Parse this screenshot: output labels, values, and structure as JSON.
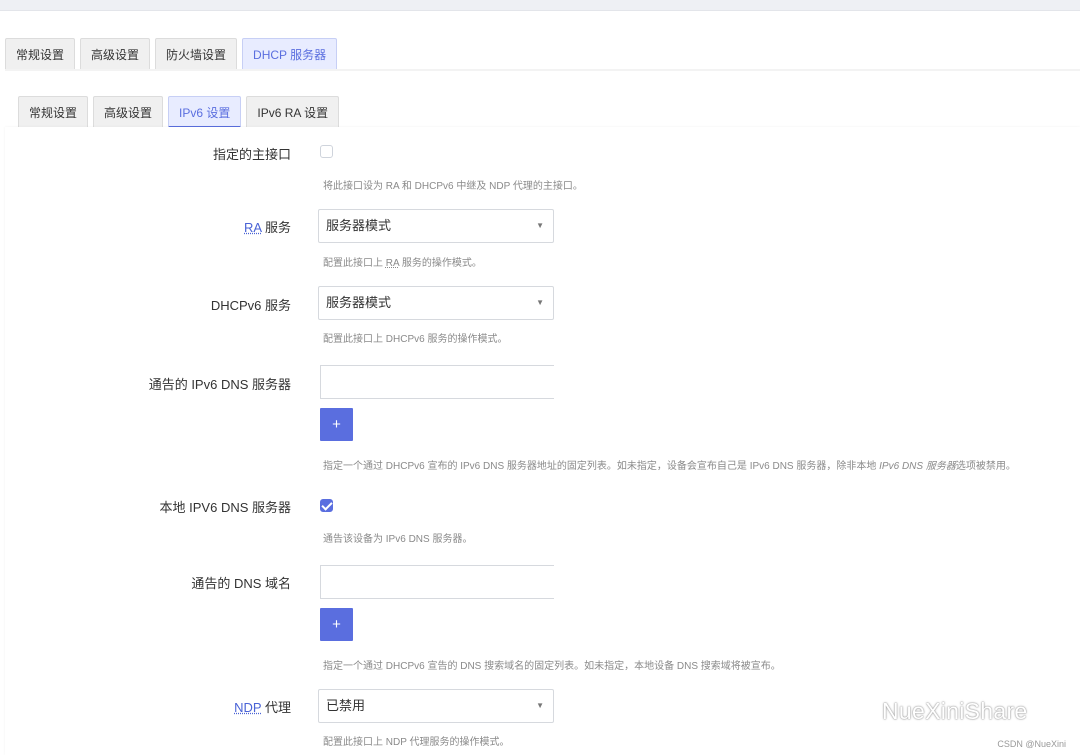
{
  "top_tabs": [
    "常规设置",
    "高级设置",
    "防火墙设置",
    "DHCP 服务器"
  ],
  "sub_tabs": [
    "常规设置",
    "高级设置",
    "IPv6 设置",
    "IPv6 RA 设置"
  ],
  "fields": {
    "master": {
      "label": "指定的主接口",
      "checked": false,
      "help": "将此接口设为 RA 和 DHCPv6 中继及 NDP 代理的主接口。"
    },
    "ra_service": {
      "label_abbr": "RA",
      "label_rest": " 服务",
      "value": "服务器模式",
      "help_pre": "配置此接口上 ",
      "help_abbr": "RA",
      "help_post": " 服务的操作模式。"
    },
    "dhcpv6_service": {
      "label": "DHCPv6 服务",
      "value": "服务器模式",
      "help": "配置此接口上 DHCPv6 服务的操作模式。"
    },
    "announced_dns": {
      "label": "通告的 IPv6 DNS 服务器",
      "value": "",
      "add_label": "+",
      "help_pre": "指定一个通过 DHCPv6 宣布的 IPv6 DNS 服务器地址的固定列表。如未指定，设备会宣布自己是 IPv6 DNS 服务器，除非本地 ",
      "help_em": "IPv6 DNS 服务器",
      "help_post": "选项被禁用。"
    },
    "local_dns": {
      "label": "本地 IPV6 DNS 服务器",
      "checked": true,
      "help": "通告该设备为 IPv6 DNS 服务器。"
    },
    "announced_domains": {
      "label": "通告的 DNS 域名",
      "value": "",
      "add_label": "+",
      "help": "指定一个通过 DHCPv6 宣告的 DNS 搜索域名的固定列表。如未指定，本地设备 DNS 搜索域将被宣布。"
    },
    "ndp_proxy": {
      "label_abbr": "NDP",
      "label_rest": " 代理",
      "value": "已禁用",
      "help": "配置此接口上 NDP 代理服务的操作模式。"
    }
  },
  "select_arrow": "▼",
  "watermark": "NueXiniShare",
  "credit": "CSDN @NueXini",
  "colors": {
    "accent": "#5a6edf",
    "link": "#4a63d6"
  }
}
